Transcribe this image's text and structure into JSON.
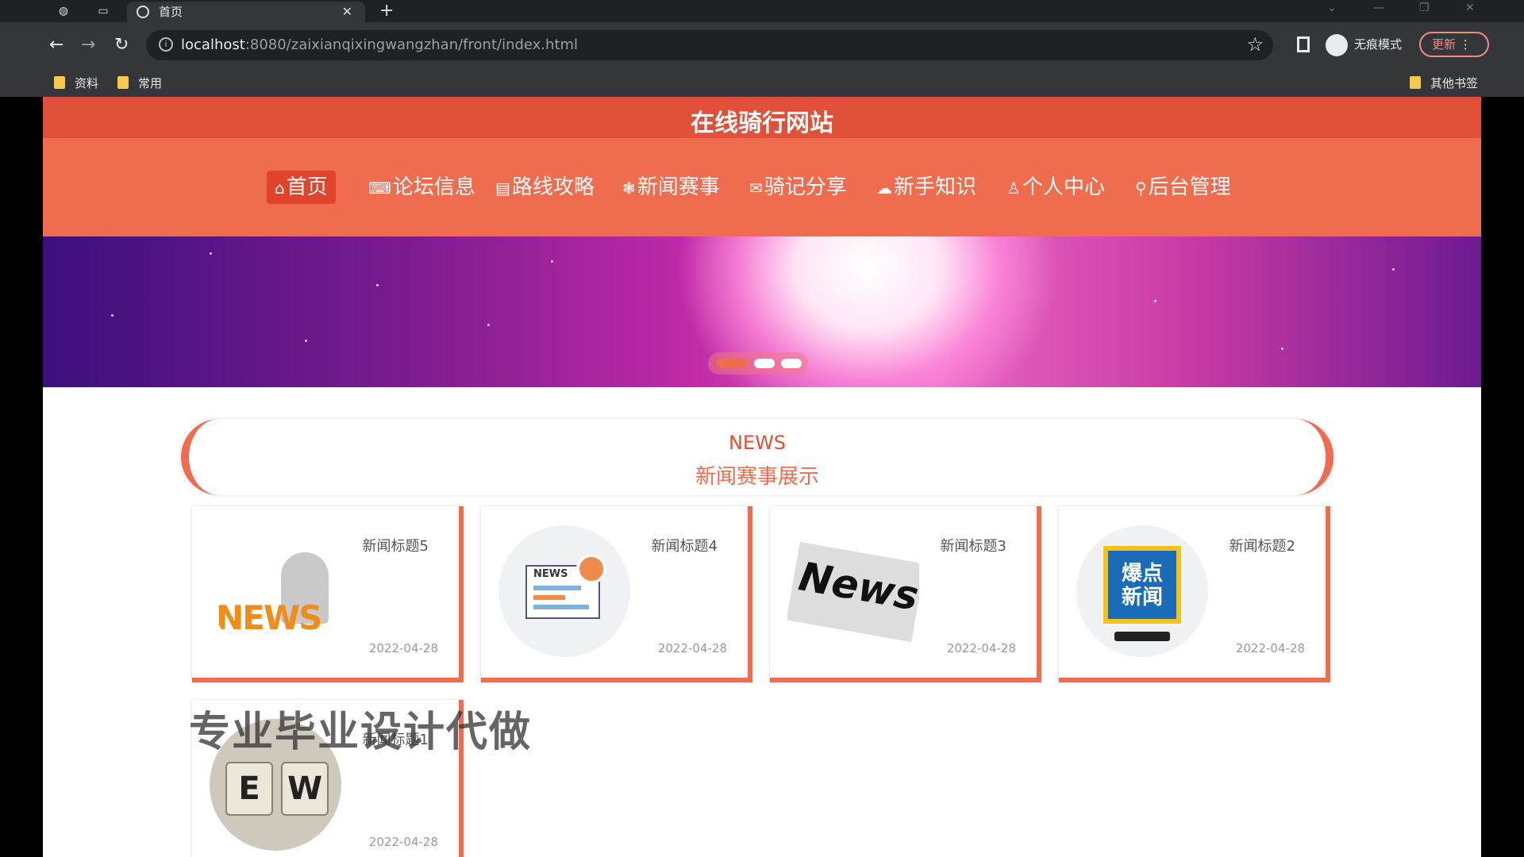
{
  "browser": {
    "tab_title": "首页",
    "url_host": "localhost",
    "url_rest": ":8080/zaixianqixingwangzhan/front/index.html",
    "incognito_label": "无痕模式",
    "update_label": "更新",
    "bookmarks": [
      "资料",
      "常用"
    ],
    "other_bookmarks": "其他书签"
  },
  "site": {
    "title": "在线骑行网站",
    "nav": [
      {
        "icon": "⌂",
        "label": "首页",
        "active": true
      },
      {
        "icon": "⌨",
        "label": "论坛信息"
      },
      {
        "icon": "▤",
        "label": "路线攻略"
      },
      {
        "icon": "❃",
        "label": "新闻赛事"
      },
      {
        "icon": "✉",
        "label": "骑记分享"
      },
      {
        "icon": "☁",
        "label": "新手知识"
      },
      {
        "icon": "♙",
        "label": "个人中心"
      },
      {
        "icon": "⚲",
        "label": "后台管理"
      }
    ],
    "carousel": {
      "total": 3,
      "active": 0
    }
  },
  "news_section": {
    "heading_en": "NEWS",
    "heading_cn": "新闻赛事展示",
    "items": [
      {
        "title": "新闻标题5",
        "date": "2022-04-28",
        "thumb": "news-3d-figure"
      },
      {
        "title": "新闻标题4",
        "date": "2022-04-28",
        "thumb": "newspaper-illustration"
      },
      {
        "title": "新闻标题3",
        "date": "2022-04-28",
        "thumb": "news-paper"
      },
      {
        "title": "新闻标题2",
        "date": "2022-04-28",
        "thumb": "breaking-news-badge"
      },
      {
        "title": "新闻标题1",
        "date": "2022-04-28",
        "thumb": "news-cubes"
      }
    ]
  },
  "badge_text": {
    "line1": "爆点",
    "line2": "新闻"
  },
  "cube_letters": [
    "E",
    "W"
  ],
  "watermark": "专业毕业设计代做",
  "colors": {
    "primary": "#f06c4f",
    "header": "#e05038",
    "active_nav": "#e0452c"
  }
}
